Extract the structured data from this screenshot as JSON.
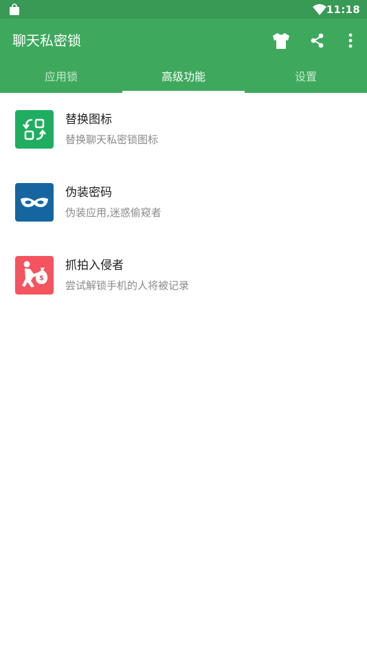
{
  "status_bar": {
    "time": "11:18",
    "left_icon": "shopping-bag-icon",
    "right_icons": [
      "wifi-icon",
      "battery-icon"
    ]
  },
  "app_bar": {
    "title": "聊天私密锁",
    "background_color": "#3ea95d",
    "actions": [
      {
        "icon": "tshirt-icon"
      },
      {
        "icon": "share-icon"
      },
      {
        "icon": "more-vertical-icon"
      }
    ]
  },
  "tabs": {
    "items": [
      {
        "label": "应用锁"
      },
      {
        "label": "高级功能"
      },
      {
        "label": "设置"
      }
    ],
    "selected": "高级功能"
  },
  "features": [
    {
      "title": "替换图标",
      "subtitle": "替换聊天私密锁图标",
      "icon": "swap-icon",
      "color": "#1fad5f"
    },
    {
      "title": "伪装密码",
      "subtitle": "伪装应用,迷惑偷窥者",
      "icon": "mask-icon",
      "color": "#1566a0"
    },
    {
      "title": "抓拍入侵者",
      "subtitle": "尝试解锁手机的人将被记录",
      "icon": "thief-icon",
      "color": "#f4545e"
    }
  ]
}
